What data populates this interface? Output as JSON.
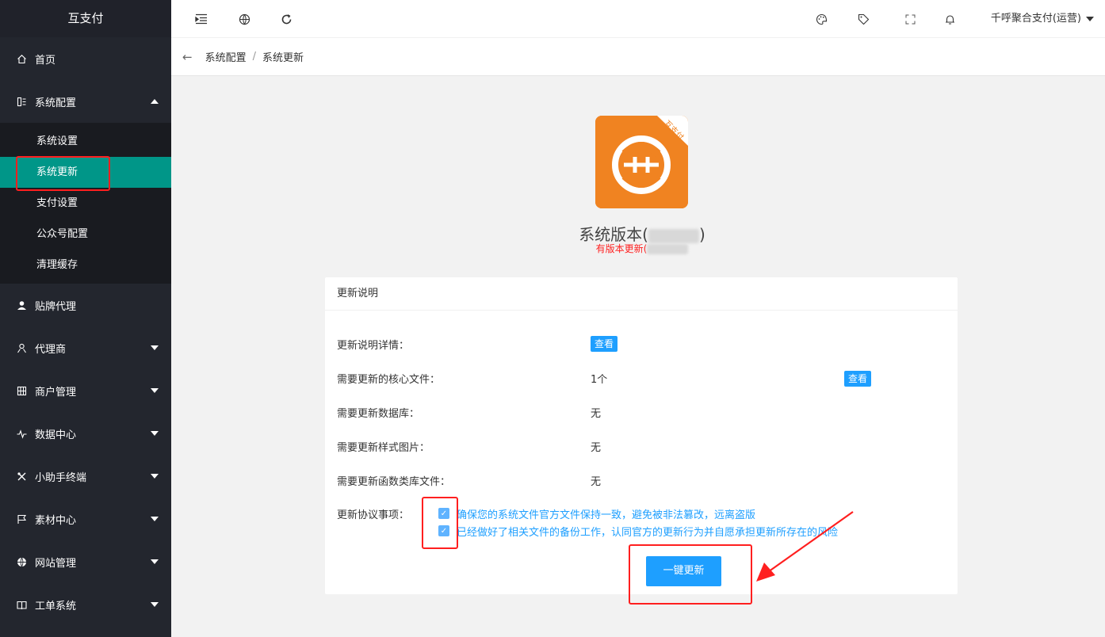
{
  "sidebar": {
    "logo": "互支付",
    "home": "首页",
    "config": "系统配置",
    "config_sub": [
      "系统设置",
      "系统更新",
      "支付设置",
      "公众号配置",
      "清理缓存"
    ],
    "items": [
      "贴牌代理",
      "代理商",
      "商户管理",
      "数据中心",
      "小助手终端",
      "素材中心",
      "网站管理",
      "工单系统"
    ]
  },
  "header": {
    "user": "千呼聚合支付(运营)"
  },
  "breadcrumb": {
    "back": "←",
    "level1": "系统配置",
    "sep": "/",
    "level2": "系统更新"
  },
  "app": {
    "badge": "互支付",
    "version_label": "系统版本(",
    "version_close": ")",
    "update_hint": "有版本更新("
  },
  "card": {
    "title": "更新说明",
    "detail_label": "更新说明详情：",
    "view": "查看",
    "core_label": "需要更新的核心文件：",
    "core_value": "1个",
    "db_label": "需要更新数据库：",
    "db_value": "无",
    "style_label": "需要更新样式图片：",
    "style_value": "无",
    "lib_label": "需要更新函数类库文件：",
    "lib_value": "无",
    "agreement_label": "更新协议事项：",
    "agree_1": "确保您的系统文件官方文件保持一致，避免被非法篡改，远离盗版",
    "agree_2": "已经做好了相关文件的备份工作，认同官方的更新行为并自愿承担更新所存在的风险",
    "update_button": "一键更新"
  },
  "colors": {
    "sidebar_bg": "#23262e",
    "active": "#009688",
    "primary": "#1e9fff",
    "annotation": "#ff1f1f",
    "app_icon": "#f08321"
  }
}
